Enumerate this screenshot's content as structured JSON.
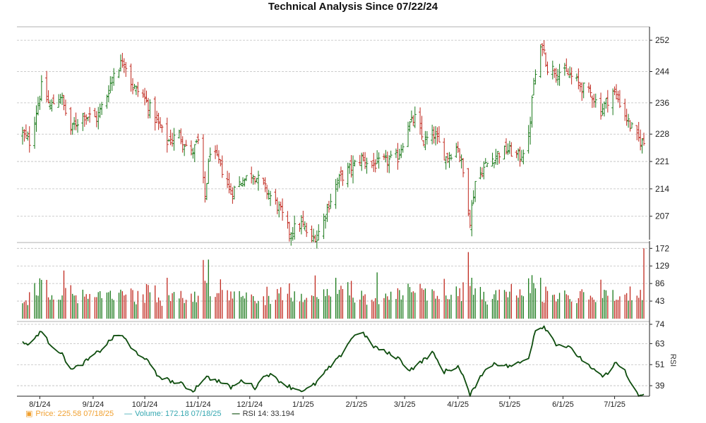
{
  "chart_data": [
    {
      "type": "candlestick",
      "panel": "price",
      "title": "Technical Analysis Since 07/22/24",
      "x_start": "07/22/24",
      "x_end": "07/18/25",
      "ylim": [
        201,
        254
      ],
      "y_ticks": [
        252,
        244,
        236,
        228,
        221,
        214,
        207
      ],
      "x_ticks": [
        "8/1/24",
        "9/1/24",
        "10/1/24",
        "11/1/24",
        "12/1/24",
        "1/1/25",
        "2/1/25",
        "3/1/25",
        "4/1/25",
        "5/1/25",
        "6/1/25",
        "7/1/25"
      ],
      "up_color": "#1b7a1b",
      "down_color": "#c0281e",
      "grid": true,
      "close_profile": [
        [
          "07/22/24",
          228
        ],
        [
          "07/26/24",
          226
        ],
        [
          "08/02/24",
          240
        ],
        [
          "08/07/24",
          235
        ],
        [
          "08/13/24",
          238
        ],
        [
          "08/19/24",
          229
        ],
        [
          "08/26/24",
          233
        ],
        [
          "09/03/24",
          232
        ],
        [
          "09/09/24",
          238
        ],
        [
          "09/13/24",
          244
        ],
        [
          "09/19/24",
          247
        ],
        [
          "09/24/24",
          240
        ],
        [
          "09/30/24",
          238
        ],
        [
          "10/07/24",
          232
        ],
        [
          "10/14/24",
          226
        ],
        [
          "10/21/24",
          228
        ],
        [
          "10/28/24",
          223
        ],
        [
          "11/01/24",
          226
        ],
        [
          "11/05/24",
          212
        ],
        [
          "11/08/24",
          224
        ],
        [
          "11/14/24",
          220
        ],
        [
          "11/20/24",
          213
        ],
        [
          "11/26/24",
          216
        ],
        [
          "12/03/24",
          218
        ],
        [
          "12/10/24",
          214
        ],
        [
          "12/18/24",
          209
        ],
        [
          "12/24/24",
          203
        ],
        [
          "12/31/24",
          205
        ],
        [
          "01/06/25",
          201
        ],
        [
          "01/10/25",
          203
        ],
        [
          "01/15/25",
          209
        ],
        [
          "01/21/25",
          216
        ],
        [
          "01/28/25",
          219
        ],
        [
          "02/04/25",
          222
        ],
        [
          "02/10/25",
          220
        ],
        [
          "02/18/25",
          221
        ],
        [
          "02/25/25",
          222
        ],
        [
          "03/03/25",
          230
        ],
        [
          "03/07/25",
          232
        ],
        [
          "03/12/25",
          226
        ],
        [
          "03/18/25",
          228
        ],
        [
          "03/25/25",
          222
        ],
        [
          "04/01/25",
          225
        ],
        [
          "04/04/25",
          218
        ],
        [
          "04/08/25",
          206
        ],
        [
          "04/11/25",
          216
        ],
        [
          "04/17/25",
          220
        ],
        [
          "04/24/25",
          223
        ],
        [
          "04/30/25",
          224
        ],
        [
          "05/07/25",
          222
        ],
        [
          "05/12/25",
          227
        ],
        [
          "05/15/25",
          241
        ],
        [
          "05/20/25",
          251
        ],
        [
          "05/23/25",
          245
        ],
        [
          "05/30/25",
          244
        ],
        [
          "06/05/25",
          243
        ],
        [
          "06/12/25",
          240
        ],
        [
          "06/18/25",
          238
        ],
        [
          "06/23/25",
          234
        ],
        [
          "06/30/25",
          239
        ],
        [
          "07/03/25",
          237
        ],
        [
          "07/09/25",
          231
        ],
        [
          "07/14/25",
          227
        ],
        [
          "07/18/25",
          225.58
        ]
      ]
    },
    {
      "type": "bar",
      "panel": "volume",
      "ylim": [
        0,
        176
      ],
      "y_ticks": [
        172,
        129,
        86,
        43
      ],
      "up_color": "#1b7a1b",
      "down_color": "#c0281e",
      "last_value": 172.18
    },
    {
      "type": "line",
      "panel": "rsi",
      "ylabel": "RSI",
      "ylim": [
        33,
        74
      ],
      "y_ticks": [
        74,
        63,
        51,
        39
      ],
      "color": "#0e4d0e",
      "profile": [
        [
          "07/22/24",
          64
        ],
        [
          "07/26/24",
          62
        ],
        [
          "08/01/24",
          70
        ],
        [
          "08/07/24",
          63
        ],
        [
          "08/13/24",
          58
        ],
        [
          "08/20/24",
          48
        ],
        [
          "08/28/24",
          53
        ],
        [
          "09/05/24",
          59
        ],
        [
          "09/12/24",
          66
        ],
        [
          "09/18/24",
          68
        ],
        [
          "09/23/24",
          60
        ],
        [
          "10/01/24",
          55
        ],
        [
          "10/08/24",
          45
        ],
        [
          "10/15/24",
          42
        ],
        [
          "10/22/24",
          40
        ],
        [
          "10/29/24",
          36
        ],
        [
          "11/05/24",
          44
        ],
        [
          "11/12/24",
          42
        ],
        [
          "11/20/24",
          38
        ],
        [
          "11/27/24",
          42
        ],
        [
          "12/04/24",
          38
        ],
        [
          "12/11/24",
          46
        ],
        [
          "12/18/24",
          42
        ],
        [
          "12/25/24",
          38
        ],
        [
          "01/02/25",
          36
        ],
        [
          "01/08/25",
          40
        ],
        [
          "01/15/25",
          48
        ],
        [
          "01/22/25",
          55
        ],
        [
          "01/29/25",
          66
        ],
        [
          "02/04/25",
          70
        ],
        [
          "02/10/25",
          62
        ],
        [
          "02/18/25",
          58
        ],
        [
          "02/25/25",
          55
        ],
        [
          "03/04/25",
          48
        ],
        [
          "03/10/25",
          52
        ],
        [
          "03/17/25",
          58
        ],
        [
          "03/24/25",
          47
        ],
        [
          "04/01/25",
          50
        ],
        [
          "04/04/25",
          44
        ],
        [
          "04/08/25",
          33
        ],
        [
          "04/14/25",
          45
        ],
        [
          "04/22/25",
          52
        ],
        [
          "04/30/25",
          50
        ],
        [
          "05/07/25",
          52
        ],
        [
          "05/12/25",
          55
        ],
        [
          "05/16/25",
          71
        ],
        [
          "05/21/25",
          73
        ],
        [
          "05/28/25",
          63
        ],
        [
          "06/04/25",
          61
        ],
        [
          "06/11/25",
          55
        ],
        [
          "06/18/25",
          48
        ],
        [
          "06/25/25",
          44
        ],
        [
          "07/01/25",
          52
        ],
        [
          "07/07/25",
          48
        ],
        [
          "07/10/25",
          40
        ],
        [
          "07/15/25",
          33.194
        ],
        [
          "07/18/25",
          33.194
        ]
      ]
    }
  ],
  "legend": {
    "price_label": "Price: 225.58  07/18/25",
    "volume_label": "Volume: 172.18  07/18/25",
    "rsi_label": "RSI 14: 33.194"
  }
}
